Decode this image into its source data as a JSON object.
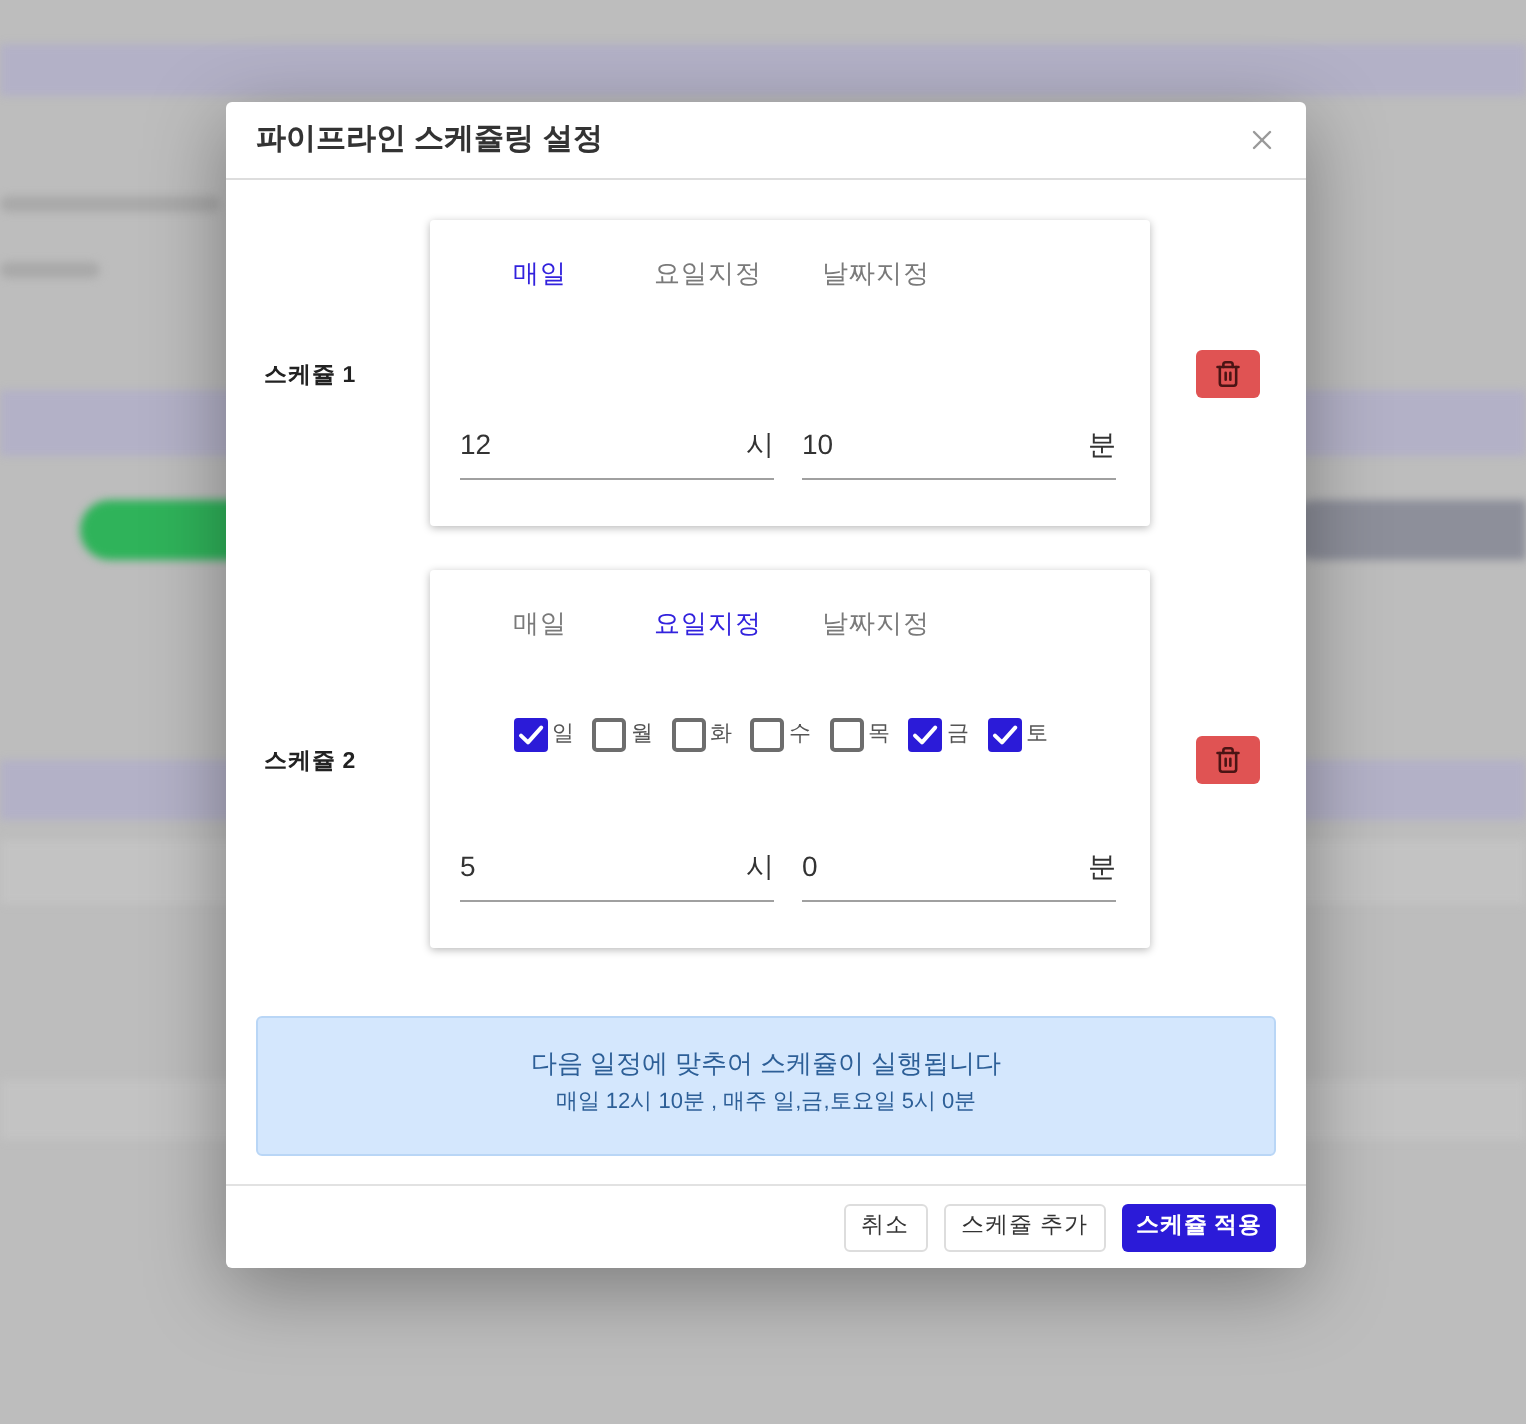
{
  "dialog": {
    "title": "파이프라인 스케쥴링 설정"
  },
  "schedules": [
    {
      "label": "스케쥴 1",
      "tabs": [
        {
          "label": "매일",
          "selected": true
        },
        {
          "label": "요일지정",
          "selected": false
        },
        {
          "label": "날짜지정",
          "selected": false
        }
      ],
      "hour": {
        "value": "12",
        "unit": "시"
      },
      "minute": {
        "value": "10",
        "unit": "분"
      }
    },
    {
      "label": "스케쥴 2",
      "tabs": [
        {
          "label": "매일",
          "selected": false
        },
        {
          "label": "요일지정",
          "selected": true
        },
        {
          "label": "날짜지정",
          "selected": false
        }
      ],
      "weekdays": [
        {
          "label": "일",
          "checked": true
        },
        {
          "label": "월",
          "checked": false
        },
        {
          "label": "화",
          "checked": false
        },
        {
          "label": "수",
          "checked": false
        },
        {
          "label": "목",
          "checked": false
        },
        {
          "label": "금",
          "checked": true
        },
        {
          "label": "토",
          "checked": true
        }
      ],
      "hour": {
        "value": "5",
        "unit": "시"
      },
      "minute": {
        "value": "0",
        "unit": "분"
      }
    }
  ],
  "notice": {
    "title": "다음 일정에 맞추어 스케쥴이 실행됩니다",
    "summary": "매일 12시 10분 , 매주 일,금,토요일 5시 0분"
  },
  "buttons": [
    {
      "label": "취소",
      "kind": "default"
    },
    {
      "label": "스케쥴 추가",
      "kind": "default"
    },
    {
      "label": "스케쥴 적용",
      "kind": "primary"
    }
  ]
}
